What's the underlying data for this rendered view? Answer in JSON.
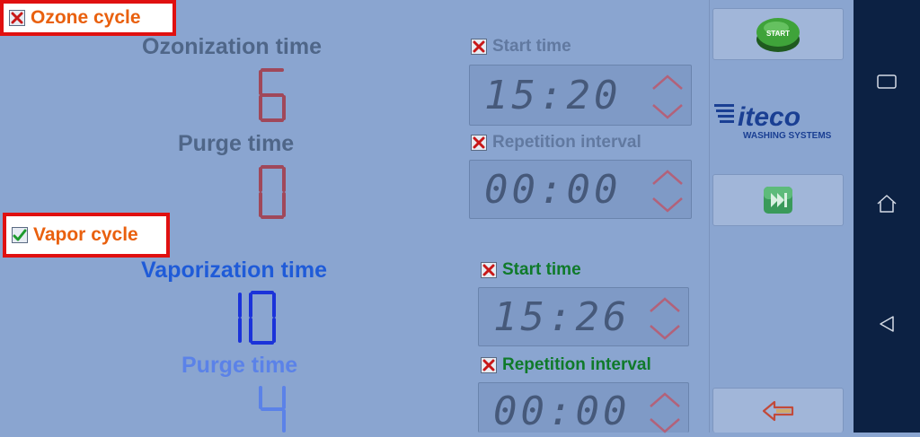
{
  "ozone": {
    "cycle_label": "Ozone cycle",
    "ozonization_label": "Ozonization time",
    "ozonization_value": "6",
    "purge_label": "Purge time",
    "purge_value": "0",
    "start_time_label": "Start time",
    "start_time_value": "15:20",
    "repetition_label": "Repetition interval",
    "repetition_value": "00:00"
  },
  "vapor": {
    "cycle_label": "Vapor cycle",
    "vaporization_label": "Vaporization time",
    "vaporization_value": "10",
    "purge_label": "Purge time",
    "purge_value": "4",
    "start_time_label": "Start time",
    "start_time_value": "15:26",
    "repetition_label": "Repetition interval",
    "repetition_value": "00:00"
  },
  "side": {
    "start_button_label": "START",
    "logo_brand": "iteco",
    "logo_tagline": "WASHING SYSTEMS"
  },
  "icons": {
    "ozone_cycle": "red-x-checkbox-icon",
    "vapor_cycle": "green-check-checkbox-icon",
    "start_time": "red-x-checkbox-icon",
    "repetition": "red-x-checkbox-icon",
    "skip": "skip-forward-icon",
    "back": "back-arrow-icon",
    "nav_recent": "recent-apps-icon",
    "nav_home": "home-icon",
    "nav_back": "nav-back-icon"
  },
  "colors": {
    "background": "#8aa5d0",
    "cycle_label": "#e9600e",
    "highlight_border": "#e01010",
    "ozone_digits": "#a0485a",
    "vapor_digits_active": "#1b33d9",
    "vapor_digits_inactive": "#5b82e8",
    "vapor_labels": "#1f5bd8",
    "green_label": "#0f7a2a",
    "navbar": "#0c2143"
  }
}
